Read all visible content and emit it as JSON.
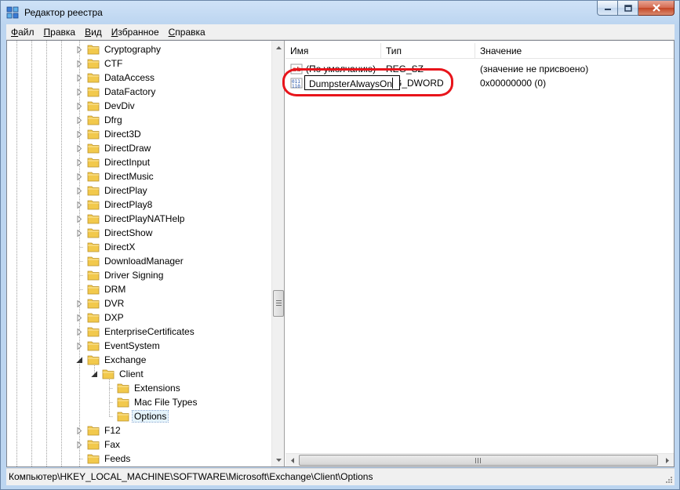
{
  "window": {
    "title": "Редактор реестра",
    "icon": "regedit-icon",
    "controls": [
      "minimize-icon",
      "maximize-icon",
      "close-icon"
    ]
  },
  "menu": [
    {
      "label": "Файл",
      "accel": "Ф",
      "rest": "айл"
    },
    {
      "label": "Правка",
      "accel": "П",
      "rest": "равка"
    },
    {
      "label": "Вид",
      "accel": "В",
      "rest": "ид"
    },
    {
      "label": "Избранное",
      "accel": "И",
      "rest": "збранное"
    },
    {
      "label": "Справка",
      "accel": "С",
      "rest": "правка"
    }
  ],
  "tree": {
    "items": [
      {
        "label": "Cryptography",
        "level": 0,
        "expander": "collapsed"
      },
      {
        "label": "CTF",
        "level": 0,
        "expander": "collapsed"
      },
      {
        "label": "DataAccess",
        "level": 0,
        "expander": "collapsed"
      },
      {
        "label": "DataFactory",
        "level": 0,
        "expander": "collapsed"
      },
      {
        "label": "DevDiv",
        "level": 0,
        "expander": "collapsed"
      },
      {
        "label": "Dfrg",
        "level": 0,
        "expander": "collapsed"
      },
      {
        "label": "Direct3D",
        "level": 0,
        "expander": "collapsed"
      },
      {
        "label": "DirectDraw",
        "level": 0,
        "expander": "collapsed"
      },
      {
        "label": "DirectInput",
        "level": 0,
        "expander": "collapsed"
      },
      {
        "label": "DirectMusic",
        "level": 0,
        "expander": "collapsed"
      },
      {
        "label": "DirectPlay",
        "level": 0,
        "expander": "collapsed"
      },
      {
        "label": "DirectPlay8",
        "level": 0,
        "expander": "collapsed"
      },
      {
        "label": "DirectPlayNATHelp",
        "level": 0,
        "expander": "collapsed"
      },
      {
        "label": "DirectShow",
        "level": 0,
        "expander": "collapsed"
      },
      {
        "label": "DirectX",
        "level": 0,
        "expander": "none"
      },
      {
        "label": "DownloadManager",
        "level": 0,
        "expander": "none"
      },
      {
        "label": "Driver Signing",
        "level": 0,
        "expander": "none"
      },
      {
        "label": "DRM",
        "level": 0,
        "expander": "none"
      },
      {
        "label": "DVR",
        "level": 0,
        "expander": "collapsed"
      },
      {
        "label": "DXP",
        "level": 0,
        "expander": "collapsed"
      },
      {
        "label": "EnterpriseCertificates",
        "level": 0,
        "expander": "collapsed"
      },
      {
        "label": "EventSystem",
        "level": 0,
        "expander": "collapsed"
      },
      {
        "label": "Exchange",
        "level": 0,
        "expander": "expanded"
      },
      {
        "label": "Client",
        "level": 1,
        "expander": "expanded"
      },
      {
        "label": "Extensions",
        "level": 2,
        "expander": "none"
      },
      {
        "label": "Mac File Types",
        "level": 2,
        "expander": "none"
      },
      {
        "label": "Options",
        "level": 2,
        "expander": "none",
        "selected": true
      },
      {
        "label": "F12",
        "level": 0,
        "expander": "collapsed"
      },
      {
        "label": "Fax",
        "level": 0,
        "expander": "collapsed"
      },
      {
        "label": "Feeds",
        "level": 0,
        "expander": "none"
      }
    ]
  },
  "values_pane": {
    "columns": [
      "Имя",
      "Тип",
      "Значение"
    ],
    "rows": [
      {
        "icon": "string-value-icon",
        "name": "(По умолчанию)",
        "type": "REG_SZ",
        "data": "(значение не присвоено)"
      },
      {
        "icon": "binary-value-icon",
        "name": "DumpsterAlwaysOn",
        "type": "G_DWORD",
        "data": "0x00000000 (0)",
        "editing": true
      }
    ]
  },
  "statusbar": {
    "path": "Компьютер\\HKEY_LOCAL_MACHINE\\SOFTWARE\\Microsoft\\Exchange\\Client\\Options"
  },
  "colors": {
    "highlight_annotation": "#e8141b",
    "folder": "#f2c94c",
    "selection": "#e5f3fb"
  }
}
